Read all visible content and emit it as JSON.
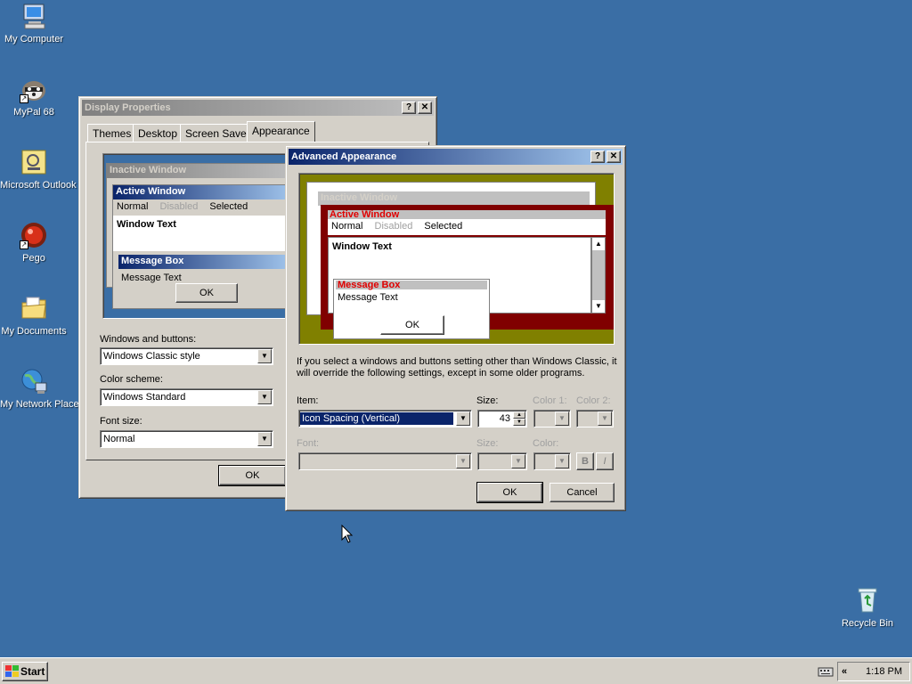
{
  "desktop": {
    "icons": [
      {
        "label": "My Computer"
      },
      {
        "label": "MyPal 68"
      },
      {
        "label": "Microsoft Outlook"
      },
      {
        "label": "Pego"
      },
      {
        "label": "My Documents"
      },
      {
        "label": "My Network Places"
      },
      {
        "label": "Recycle Bin"
      }
    ]
  },
  "display_properties": {
    "title": "Display Properties",
    "help_btn": "?",
    "close_btn": "✕",
    "tabs": [
      "Themes",
      "Desktop",
      "Screen Saver",
      "Appearance"
    ],
    "selected_tab": "Appearance",
    "preview": {
      "inactive_title": "Inactive Window",
      "active_title": "Active Window",
      "menu": [
        "Normal",
        "Disabled",
        "Selected"
      ],
      "window_text": "Window Text",
      "msgbox_title": "Message Box",
      "msgbox_text": "Message Text",
      "ok": "OK"
    },
    "windows_buttons_label": "Windows and buttons:",
    "windows_buttons_value": "Windows Classic style",
    "color_scheme_label": "Color scheme:",
    "color_scheme_value": "Windows Standard",
    "font_size_label": "Font size:",
    "font_size_value": "Normal",
    "ok": "OK"
  },
  "advanced": {
    "title": "Advanced Appearance",
    "help_btn": "?",
    "close_btn": "✕",
    "preview": {
      "inactive_title": "Inactive Window",
      "active_title": "Active Window",
      "menu": [
        "Normal",
        "Disabled",
        "Selected"
      ],
      "window_text": "Window Text",
      "msgbox_title": "Message Box",
      "msgbox_text": "Message Text",
      "ok": "OK"
    },
    "info_text": "If you select a windows and buttons setting other than Windows Classic, it will override the following settings, except in some older programs.",
    "item_label": "Item:",
    "item_value": "Icon Spacing (Vertical)",
    "size_label": "Size:",
    "size_value": "43",
    "color1_label": "Color 1:",
    "color2_label": "Color 2:",
    "font_label": "Font:",
    "font_size_label": "Size:",
    "font_color_label": "Color:",
    "bold": "B",
    "italic": "I",
    "ok": "OK",
    "cancel": "Cancel"
  },
  "taskbar": {
    "start": "Start",
    "chevron": "«",
    "clock": "1:18 PM"
  },
  "colors": {
    "desktop": "#3a6ea5",
    "face": "#d4d0c8",
    "active_title": "#0a246a",
    "preview_scheme_bg": "#808000",
    "preview_active_title": "#800000"
  }
}
